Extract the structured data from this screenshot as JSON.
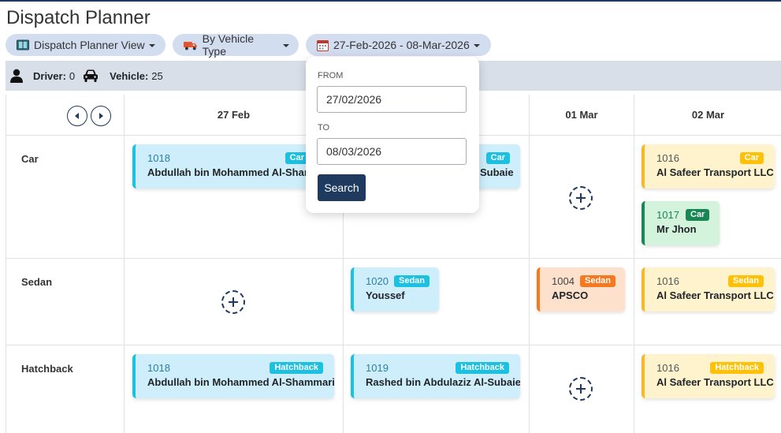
{
  "title": "Dispatch Planner",
  "filters": {
    "view_label": "Dispatch Planner View",
    "group_label": "By Vehicle Type",
    "date_range_label": "27-Feb-2026 - 08-Mar-2026"
  },
  "status": {
    "driver_label": "Driver:",
    "driver_count": "0",
    "vehicle_label": "Vehicle:",
    "vehicle_count": "25"
  },
  "columns": [
    "27 Feb",
    "",
    "01 Mar",
    "02 Mar"
  ],
  "rows": [
    "Car",
    "Sedan",
    "Hatchback"
  ],
  "cards": [
    {
      "num": "1018",
      "badge": "Car",
      "name": "Abdullah bin Mohammed Al-Shammari",
      "color": "blue"
    },
    {
      "num": "",
      "badge": "Car",
      "name": "Subaie",
      "color": "blue"
    },
    {
      "num": "1016",
      "badge": "Car",
      "name": "Al Safeer Transport LLC",
      "color": "yellow"
    },
    {
      "num": "1017",
      "badge": "Car",
      "name": "Mr Jhon",
      "color": "green"
    },
    {
      "num": "1020",
      "badge": "Sedan",
      "name": "Youssef",
      "color": "blue"
    },
    {
      "num": "1004",
      "badge": "Sedan",
      "name": "APSCO",
      "color": "orange"
    },
    {
      "num": "1016",
      "badge": "Sedan",
      "name": "Al Safeer Transport LLC",
      "color": "yellow"
    },
    {
      "num": "1018",
      "badge": "Hatchback",
      "name": "Abdullah bin Mohammed Al-Shammari",
      "color": "blue"
    },
    {
      "num": "1019",
      "badge": "Hatchback",
      "name": "Rashed bin Abdulaziz Al-Subaie",
      "color": "blue"
    },
    {
      "num": "1016",
      "badge": "Hatchback",
      "name": "Al Safeer Transport LLC",
      "color": "yellow"
    }
  ],
  "date_popup": {
    "from_label": "FROM",
    "from_value": "27/02/2026",
    "to_label": "TO",
    "to_value": "08/03/2026",
    "search_label": "Search"
  },
  "colors": {
    "primary": "#1e3a5f",
    "pill_bg": "#d3ddf0",
    "status_bg": "#d8dfe9",
    "card_blue": "#cfeefb",
    "card_yellow": "#fff3cd",
    "card_green": "#d4f3dc",
    "card_orange": "#fde1cc"
  },
  "icons": {
    "view": "map-book-icon",
    "group": "truck-icon",
    "date": "calendar-icon",
    "driver": "person-icon",
    "vehicle": "car-icon",
    "prev": "chevron-left-icon",
    "next": "chevron-right-icon",
    "add": "plus-icon"
  }
}
